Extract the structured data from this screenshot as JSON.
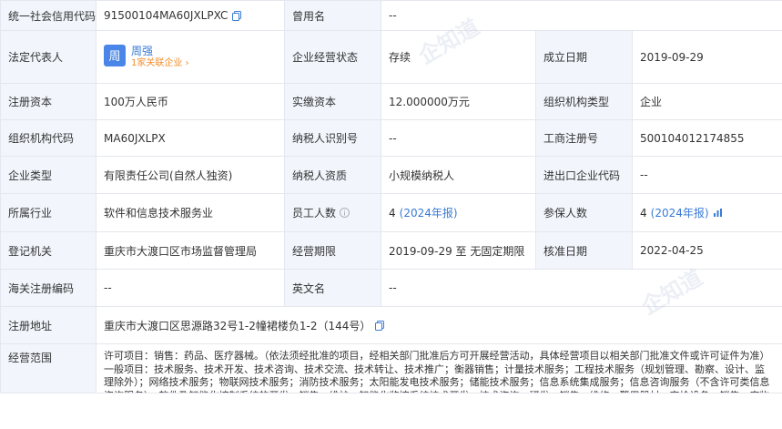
{
  "fields": {
    "credit_code_label": "统一社会信用代码",
    "credit_code_value": "91500104MA60JXLPXC",
    "former_name_label": "曾用名",
    "former_name_value": "--",
    "legal_rep_label": "法定代表人",
    "legal_rep_avatar": "周",
    "legal_rep_name": "周强",
    "legal_rep_assoc": "1家关联企业 ›",
    "status_label": "企业经营状态",
    "status_value": "存续",
    "established_label": "成立日期",
    "established_value": "2019-09-29",
    "reg_capital_label": "注册资本",
    "reg_capital_value": "100万人民币",
    "paid_capital_label": "实缴资本",
    "paid_capital_value": "12.000000万元",
    "org_type_label": "组织机构类型",
    "org_type_value": "企业",
    "org_code_label": "组织机构代码",
    "org_code_value": "MA60JXLPX",
    "taxpayer_id_label": "纳税人识别号",
    "taxpayer_id_value": "--",
    "biz_reg_label": "工商注册号",
    "biz_reg_value": "500104012174855",
    "company_type_label": "企业类型",
    "company_type_value": "有限责任公司(自然人独资)",
    "taxpayer_qual_label": "纳税人资质",
    "taxpayer_qual_value": "小规模纳税人",
    "import_export_label": "进出口企业代码",
    "import_export_value": "--",
    "industry_label": "所属行业",
    "industry_value": "软件和信息技术服务业",
    "employees_label": "员工人数",
    "employees_value": "4",
    "employees_year": "(2024年报)",
    "insured_label": "参保人数",
    "insured_value": "4",
    "insured_year": "(2024年报)",
    "authority_label": "登记机关",
    "authority_value": "重庆市大渡口区市场监督管理局",
    "term_label": "经营期限",
    "term_value": "2019-09-29 至 无固定期限",
    "approval_label": "核准日期",
    "approval_value": "2022-04-25",
    "customs_label": "海关注册编码",
    "customs_value": "--",
    "english_label": "英文名",
    "english_value": "--",
    "address_label": "注册地址",
    "address_value": "重庆市大渡口区思源路32号1-2幢裙楼负1-2（144号）",
    "scope_label": "经营范围",
    "scope_value": "许可项目：销售：药品、医疗器械。（依法须经批准的项目，经相关部门批准后方可开展经营活动，具体经营项目以相关部门批准文件或许可证件为准）一般项目：技术服务、技术开发、技术咨询、技术交流、技术转让、技术推广；衡器销售；计量技术服务；工程技术服务（规划管理、勘察、设计、监理除外）；网络技术服务；物联网技术服务；消防技术服务；太阳能发电技术服务；储能技术服务；信息系统集成服务；信息咨询服务（不含许可类信息咨询服务）；软件及智能化控制系统的开发、销售、维护；智能化监控系统技术开发、技术咨询；研发、销售、维修：警用器材、安检设备；销售：宠物饲料。（除依法须经批准的项目外，凭营业执照依法自主开展经营活动）"
  },
  "watermark": "企知道",
  "icons": [
    "copy-icon",
    "info-icon",
    "chart-icon"
  ],
  "colors": {
    "label_bg": "#f2f6fc",
    "link": "#3a7bd5",
    "accent_orange": "#f08c2a",
    "avatar": "#4a86e8"
  }
}
